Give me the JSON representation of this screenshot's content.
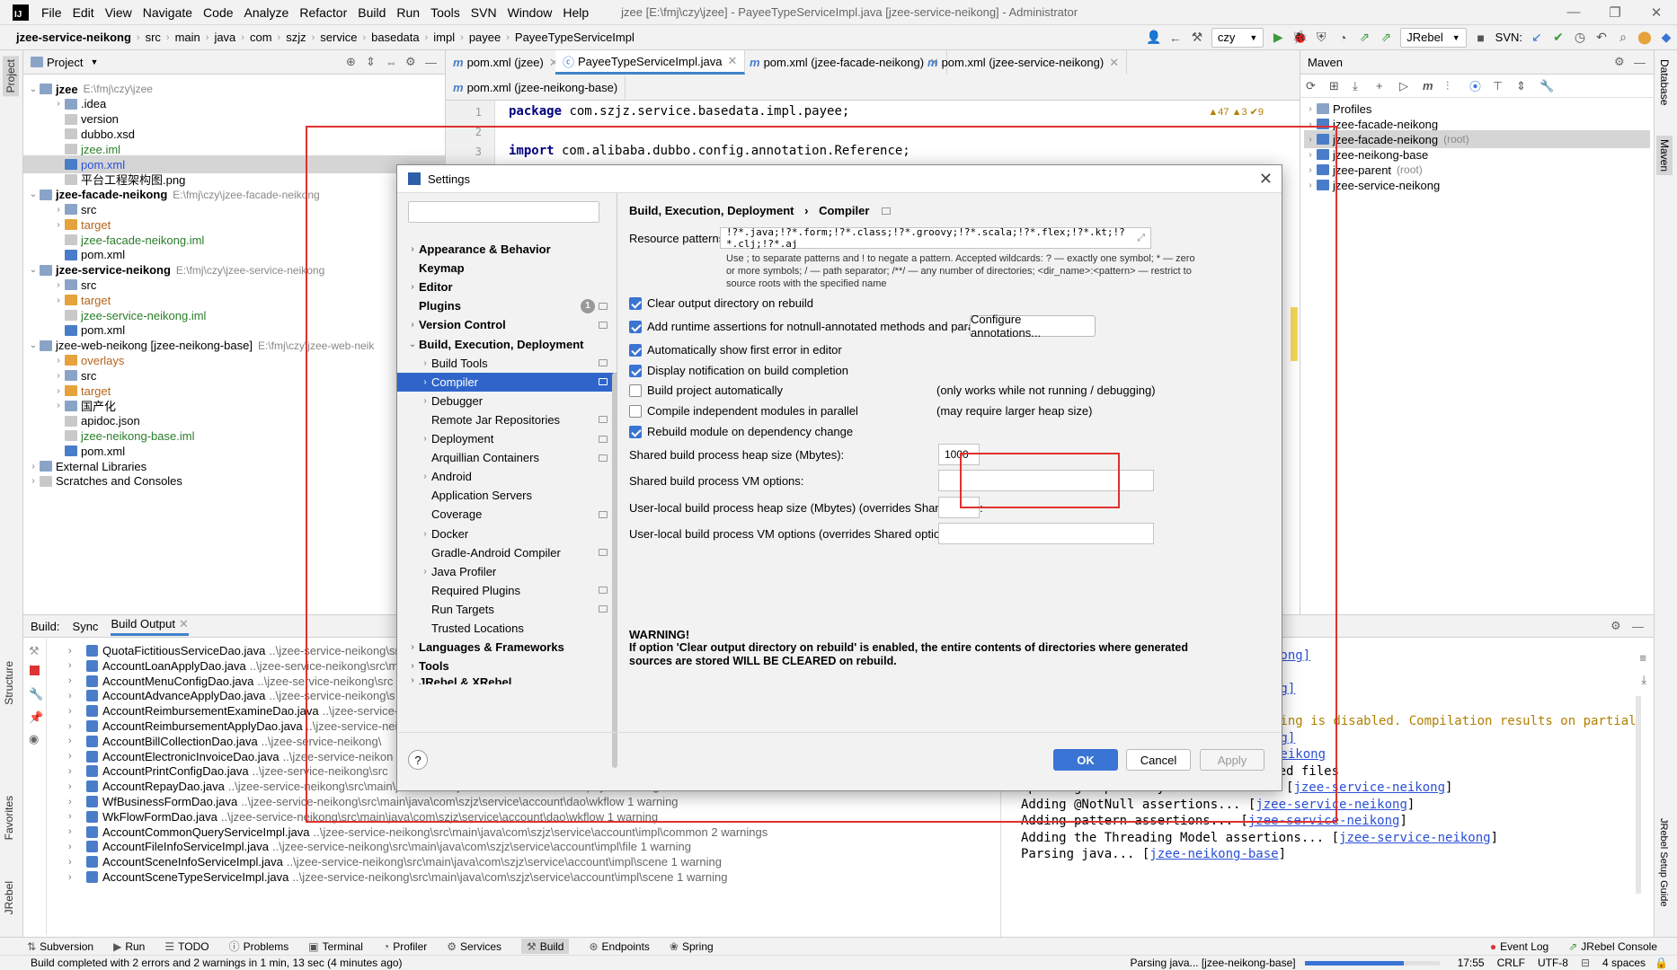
{
  "app": {
    "menu": [
      "File",
      "Edit",
      "View",
      "Navigate",
      "Code",
      "Analyze",
      "Refactor",
      "Build",
      "Run",
      "Tools",
      "SVN",
      "Window",
      "Help"
    ],
    "window_title": "jzee [E:\\fmj\\czy\\jzee] - PayeeTypeServiceImpl.java [jzee-service-neikong] - Administrator",
    "run_config": "czy",
    "jrebel_label": "JRebel",
    "svn_label": "SVN:"
  },
  "breadcrumb": [
    "jzee-service-neikong",
    "src",
    "main",
    "java",
    "com",
    "szjz",
    "service",
    "basedata",
    "impl",
    "payee",
    "PayeeTypeServiceImpl"
  ],
  "project": {
    "title": "Project",
    "rows": [
      {
        "label": "jzee",
        "dim": "E:\\fmj\\czy\\jzee",
        "bold": true
      },
      {
        "label": ".idea"
      },
      {
        "label": "version"
      },
      {
        "label": "dubbo.xsd"
      },
      {
        "label": "jzee.iml"
      },
      {
        "label": "pom.xml"
      },
      {
        "label": "平台工程架构图.png"
      },
      {
        "label": "jzee-facade-neikong",
        "dim": "E:\\fmj\\czy\\jzee-facade-neikong",
        "bold": true
      },
      {
        "label": "src"
      },
      {
        "label": "target"
      },
      {
        "label": "jzee-facade-neikong.iml"
      },
      {
        "label": "pom.xml"
      },
      {
        "label": "jzee-service-neikong",
        "dim": "E:\\fmj\\czy\\jzee-service-neikong",
        "bold": true
      },
      {
        "label": "src"
      },
      {
        "label": "target"
      },
      {
        "label": "jzee-service-neikong.iml"
      },
      {
        "label": "pom.xml"
      },
      {
        "label": "jzee-web-neikong [jzee-neikong-base]",
        "dim": "E:\\fmj\\czy\\jzee-web-neik"
      },
      {
        "label": "overlays"
      },
      {
        "label": "src"
      },
      {
        "label": "target"
      },
      {
        "label": "国产化"
      },
      {
        "label": "apidoc.json"
      },
      {
        "label": "jzee-neikong-base.iml"
      },
      {
        "label": "pom.xml"
      },
      {
        "label": "External Libraries"
      },
      {
        "label": "Scratches and Consoles"
      }
    ]
  },
  "editor_tabs": [
    "pom.xml (jzee)",
    "PayeeTypeServiceImpl.java",
    "pom.xml (jzee-facade-neikong)",
    "pom.xml (jzee-service-neikong)",
    "pom.xml (jzee-neikong-base)"
  ],
  "editor": {
    "line1_kw": "package",
    "line1_rest": " com.szjz.service.basedata.impl.payee;",
    "line3_kw": "import",
    "line3_rest": " com.alibaba.dubbo.config.annotation.Reference;",
    "line_numbers": [
      "1",
      "2",
      "3"
    ],
    "inspection": "▲47  ▲3  ✔9"
  },
  "maven": {
    "title": "Maven",
    "items": [
      {
        "label": "Profiles"
      },
      {
        "label": "jzee-facade-neikong"
      },
      {
        "label": "jzee-facade-neikong",
        "dim": "(root)"
      },
      {
        "label": "jzee-neikong-base"
      },
      {
        "label": "jzee-parent",
        "dim": "(root)"
      },
      {
        "label": "jzee-service-neikong"
      }
    ]
  },
  "side_tabs": {
    "left": [
      "Project",
      "Structure",
      "Favorites",
      "JRebel"
    ],
    "right": [
      "Database",
      "Maven",
      "JRebel Setup Guide"
    ]
  },
  "build": {
    "label": "Build:",
    "tabs": [
      "Sync",
      "Build Output"
    ],
    "rows": [
      {
        "name": "QuotaFictitiousServiceDao.java",
        "path": "..\\jzee-service-neikong\\src"
      },
      {
        "name": "AccountLoanApplyDao.java",
        "path": "..\\jzee-service-neikong\\src\\m"
      },
      {
        "name": "AccountMenuConfigDao.java",
        "path": "..\\jzee-service-neikong\\src"
      },
      {
        "name": "AccountAdvanceApplyDao.java",
        "path": "..\\jzee-service-neikong\\s"
      },
      {
        "name": "AccountReimbursementExamineDao.java",
        "path": "..\\jzee-service-ne"
      },
      {
        "name": "AccountReimbursementApplyDao.java",
        "path": "..\\jzee-service-neik"
      },
      {
        "name": "AccountBillCollectionDao.java",
        "path": "..\\jzee-service-neikong\\"
      },
      {
        "name": "AccountElectronicInvoiceDao.java",
        "path": "..\\jzee-service-neikon"
      },
      {
        "name": "AccountPrintConfigDao.java",
        "path": "..\\jzee-service-neikong\\src"
      },
      {
        "name": "AccountRepayDao.java",
        "path": "..\\jzee-service-neikong\\src\\main\\java\\com\\szjz\\service\\account\\dao\\repay 2 warnings"
      },
      {
        "name": "WfBusinessFormDao.java",
        "path": "..\\jzee-service-neikong\\src\\main\\java\\com\\szjz\\service\\account\\dao\\wkflow 1 warning"
      },
      {
        "name": "WkFlowFormDao.java",
        "path": "..\\jzee-service-neikong\\src\\main\\java\\com\\szjz\\service\\account\\dao\\wkflow 1 warning"
      },
      {
        "name": "AccountCommonQueryServiceImpl.java",
        "path": "..\\jzee-service-neikong\\src\\main\\java\\com\\szjz\\service\\account\\impl\\common 2 warnings"
      },
      {
        "name": "AccountFileInfoServiceImpl.java",
        "path": "..\\jzee-service-neikong\\src\\main\\java\\com\\szjz\\service\\account\\impl\\file 1 warning"
      },
      {
        "name": "AccountSceneInfoServiceImpl.java",
        "path": "..\\jzee-service-neikong\\src\\main\\java\\com\\szjz\\service\\account\\impl\\scene 1 warning"
      },
      {
        "name": "AccountSceneTypeServiceImpl.java",
        "path": "..\\jzee-service-neikong\\src\\main\\java\\com\\szjz\\service\\account\\impl\\scene 1 warning"
      }
    ],
    "console": {
      "top_links": [
        "kong]",
        "]",
        "ng]"
      ],
      "warn": "sing is disabled. Compilation results on partial",
      "mid_links": [
        "ng]",
        "neikong"
      ],
      "line1": "Dependency analysis found 0 affected files",
      "line2_text": "Updating dependency information... [",
      "line2_link": "jzee-service-neikong",
      "line3_text": "Adding @NotNull assertions... [",
      "line3_link": "jzee-service-neikong",
      "line4_text": "Adding pattern assertions... [",
      "line4_link": "jzee-service-neikong",
      "line5_text": "Adding the Threading Model assertions... [",
      "line5_link": "jzee-service-neikong",
      "line6_text": "Parsing java... [",
      "line6_link": "jzee-neikong-base",
      "close": "]"
    }
  },
  "bottom_tools": [
    "Subversion",
    "Run",
    "TODO",
    "Problems",
    "Terminal",
    "Profiler",
    "Services",
    "Build",
    "Endpoints",
    "Spring"
  ],
  "bottom_tools_right": [
    "Event Log",
    "JRebel Console"
  ],
  "status": {
    "message": "Build completed with 2 errors and 2 warnings in 1 min, 13 sec (4 minutes ago)",
    "task": "Parsing java... [jzee-neikong-base]",
    "time": "17:55",
    "line_sep": "CRLF",
    "encoding": "UTF-8",
    "indent": "4 spaces"
  },
  "dialog": {
    "title": "Settings",
    "tree": [
      {
        "label": "Appearance & Behavior",
        "level": 0,
        "bold": true,
        "arrow": true
      },
      {
        "label": "Keymap",
        "level": 0,
        "bold": true,
        "arrow": false
      },
      {
        "label": "Editor",
        "level": 0,
        "bold": true,
        "arrow": true
      },
      {
        "label": "Plugins",
        "level": 0,
        "bold": true,
        "arrow": false,
        "badge": "1",
        "mark": true
      },
      {
        "label": "Version Control",
        "level": 0,
        "bold": true,
        "arrow": true,
        "mark": true
      },
      {
        "label": "Build, Execution, Deployment",
        "level": 0,
        "bold": true,
        "arrow": true,
        "open": true
      },
      {
        "label": "Build Tools",
        "level": 1,
        "arrow": true,
        "mark": true
      },
      {
        "label": "Compiler",
        "level": 1,
        "arrow": true,
        "mark": true,
        "selected": true
      },
      {
        "label": "Debugger",
        "level": 1,
        "arrow": true
      },
      {
        "label": "Remote Jar Repositories",
        "level": 1,
        "arrow": false,
        "mark": true
      },
      {
        "label": "Deployment",
        "level": 1,
        "arrow": true,
        "mark": true
      },
      {
        "label": "Arquillian Containers",
        "level": 1,
        "arrow": false,
        "mark": true
      },
      {
        "label": "Android",
        "level": 1,
        "arrow": true
      },
      {
        "label": "Application Servers",
        "level": 1,
        "arrow": false
      },
      {
        "label": "Coverage",
        "level": 1,
        "arrow": false,
        "mark": true
      },
      {
        "label": "Docker",
        "level": 1,
        "arrow": true
      },
      {
        "label": "Gradle-Android Compiler",
        "level": 1,
        "arrow": false,
        "mark": true
      },
      {
        "label": "Java Profiler",
        "level": 1,
        "arrow": true
      },
      {
        "label": "Required Plugins",
        "level": 1,
        "arrow": false,
        "mark": true
      },
      {
        "label": "Run Targets",
        "level": 1,
        "arrow": false,
        "mark": true
      },
      {
        "label": "Trusted Locations",
        "level": 1,
        "arrow": false
      },
      {
        "label": "Languages & Frameworks",
        "level": 0,
        "bold": true,
        "arrow": true
      },
      {
        "label": "Tools",
        "level": 0,
        "bold": true,
        "arrow": true
      },
      {
        "label": "JRebel & XRebel",
        "level": 0,
        "bold": true,
        "arrow": true
      }
    ],
    "crumb_parent": "Build, Execution, Deployment",
    "crumb_sep": "›",
    "crumb_current": "Compiler",
    "resource_label": "Resource patterns:",
    "resource_value": "!?*.java;!?*.form;!?*.class;!?*.groovy;!?*.scala;!?*.flex;!?*.kt;!?*.clj;!?*.aj",
    "resource_help_1": "Use ; to separate patterns and ! to negate a pattern. Accepted wildcards: ? — exactly one symbol; * — zero",
    "resource_help_2": "or more symbols; / — path separator; /**/ — any number of directories; <dir_name>:<pattern> — restrict to",
    "resource_help_3": "source roots with the specified name",
    "opt_clear": "Clear output directory on rebuild",
    "opt_assert": "Add runtime assertions for notnull-annotated methods and parameters",
    "configure_btn": "Configure annotations...",
    "opt_first_error": "Automatically show first error in editor",
    "opt_notify": "Display notification on build completion",
    "opt_auto": "Build project automatically",
    "opt_auto_note": "(only works while not running / debugging)",
    "opt_parallel": "Compile independent modules in parallel",
    "opt_parallel_note": "(may require larger heap size)",
    "opt_rebuild": "Rebuild module on dependency change",
    "heap_label": "Shared build process heap size (Mbytes):",
    "heap_value": "1000",
    "vm_label": "Shared build process VM options:",
    "user_heap_label": "User-local build process heap size (Mbytes) (overrides Shared size):",
    "user_vm_label": "User-local build process VM options (overrides Shared options):",
    "warning_title": "WARNING!",
    "warning_1": "If option 'Clear output directory on rebuild' is enabled, the entire contents of directories where generated",
    "warning_2": "sources are stored WILL BE CLEARED on rebuild.",
    "ok": "OK",
    "cancel": "Cancel",
    "apply": "Apply",
    "help": "?",
    "checks": {
      "clear": true,
      "assert": true,
      "first_error": true,
      "notify": true,
      "auto": false,
      "parallel": false,
      "rebuild": true
    }
  }
}
